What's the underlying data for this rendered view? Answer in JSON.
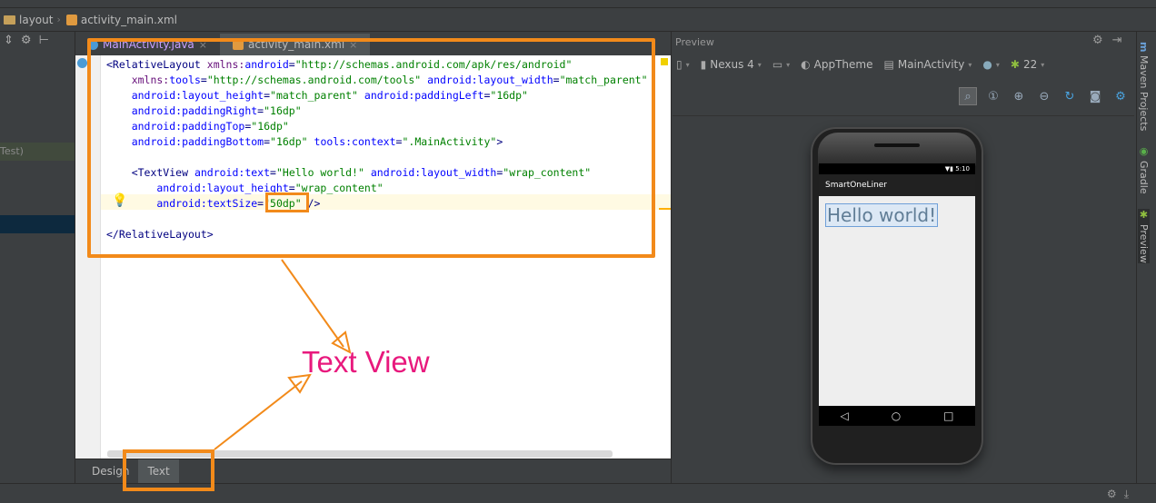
{
  "breadcrumb": {
    "folder": "layout",
    "file": "activity_main.xml"
  },
  "left_panel": {
    "test_label": "Test)"
  },
  "editor_tabs": [
    {
      "label": "MainActivity.java",
      "close": "×",
      "active": false
    },
    {
      "label": "activity_main.xml",
      "close": "×",
      "active": true
    }
  ],
  "code_lines": [
    {
      "parts": [
        [
          "tg",
          "<RelativeLayout "
        ],
        [
          "ns",
          "xmlns:"
        ],
        [
          "at",
          "android"
        ],
        [
          "tg",
          "="
        ],
        [
          "av",
          "\"http://schemas.android.com/apk/res/android\""
        ]
      ]
    },
    {
      "parts": [
        [
          "ns",
          "    xmlns:"
        ],
        [
          "at",
          "tools"
        ],
        [
          "tg",
          "="
        ],
        [
          "av",
          "\"http://schemas.android.com/tools\""
        ],
        [
          "tg",
          " "
        ],
        [
          "at",
          "android:layout_width"
        ],
        [
          "tg",
          "="
        ],
        [
          "av",
          "\"match_parent\""
        ]
      ]
    },
    {
      "parts": [
        [
          "at",
          "    android:layout_height"
        ],
        [
          "tg",
          "="
        ],
        [
          "av",
          "\"match_parent\""
        ],
        [
          "tg",
          " "
        ],
        [
          "at",
          "android:paddingLeft"
        ],
        [
          "tg",
          "="
        ],
        [
          "av",
          "\"16dp\""
        ]
      ]
    },
    {
      "parts": [
        [
          "at",
          "    android:paddingRight"
        ],
        [
          "tg",
          "="
        ],
        [
          "av",
          "\"16dp\""
        ]
      ]
    },
    {
      "parts": [
        [
          "at",
          "    android:paddingTop"
        ],
        [
          "tg",
          "="
        ],
        [
          "av",
          "\"16dp\""
        ]
      ]
    },
    {
      "parts": [
        [
          "at",
          "    android:paddingBottom"
        ],
        [
          "tg",
          "="
        ],
        [
          "av",
          "\"16dp\""
        ],
        [
          "tg",
          " "
        ],
        [
          "at",
          "tools:context"
        ],
        [
          "tg",
          "="
        ],
        [
          "av",
          "\".MainActivity\""
        ],
        [
          "tg",
          ">"
        ]
      ]
    },
    {
      "parts": [
        [
          "tg",
          ""
        ]
      ]
    },
    {
      "parts": [
        [
          "tg",
          "    <TextView "
        ],
        [
          "at",
          "android:text"
        ],
        [
          "tg",
          "="
        ],
        [
          "av",
          "\"Hello world!\""
        ],
        [
          "tg",
          " "
        ],
        [
          "at",
          "android:layout_width"
        ],
        [
          "tg",
          "="
        ],
        [
          "av",
          "\"wrap_content\""
        ]
      ]
    },
    {
      "parts": [
        [
          "at",
          "        android:layout_height"
        ],
        [
          "tg",
          "="
        ],
        [
          "av",
          "\"wrap_content\""
        ]
      ]
    },
    {
      "parts": [
        [
          "at",
          "        android:textSize"
        ],
        [
          "tg",
          "="
        ],
        [
          "av",
          "\"50dp\""
        ],
        [
          "tg",
          " />"
        ]
      ]
    },
    {
      "parts": [
        [
          "tg",
          ""
        ]
      ]
    },
    {
      "parts": [
        [
          "tg",
          "</RelativeLayout>"
        ]
      ]
    }
  ],
  "bottom_tabs": {
    "design": "Design",
    "text": "Text"
  },
  "annotation": {
    "label": "Text View",
    "color": "#e8197d",
    "box_color": "#f28a1a"
  },
  "preview": {
    "title": "Preview",
    "device": "Nexus 4",
    "theme": "AppTheme",
    "activity": "MainActivity",
    "api": "22",
    "app_name": "SmartOneLiner",
    "status_time": "5:10",
    "hello_text": "Hello world!"
  },
  "side_tabs": {
    "maven": "Maven Projects",
    "gradle": "Gradle",
    "preview": "Preview"
  }
}
